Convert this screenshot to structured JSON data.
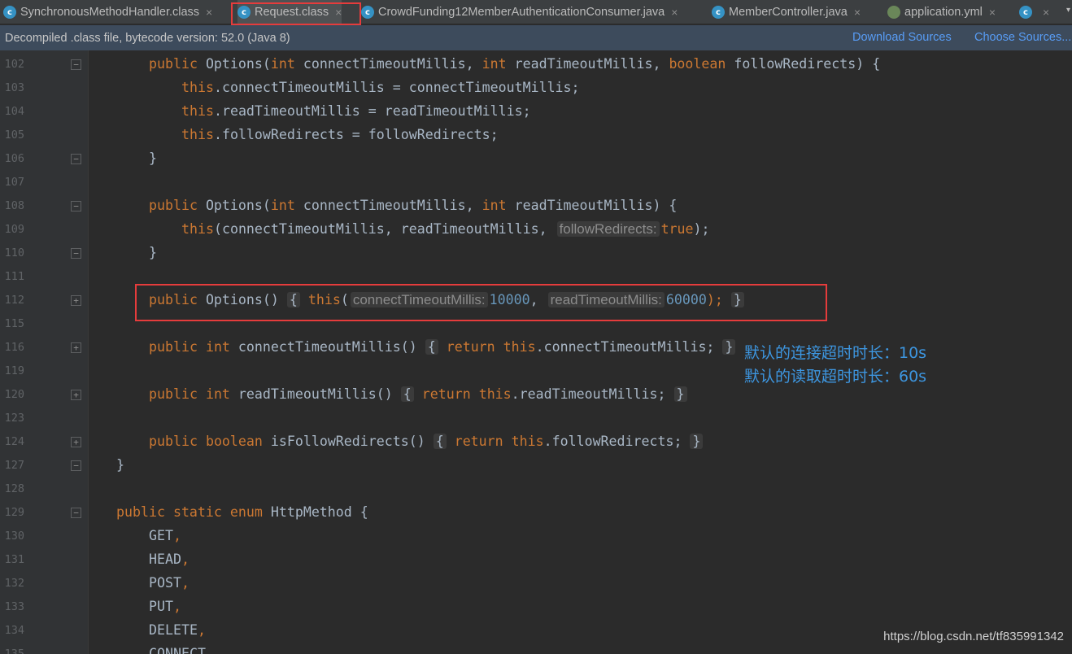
{
  "tabs": [
    {
      "label": "SynchronousMethodHandler.class",
      "icon": "class-c-icon"
    },
    {
      "label": "Request.class",
      "icon": "class-c-icon"
    },
    {
      "label": "CrowdFunding12MemberAuthenticationConsumer.java",
      "icon": "class-c-icon"
    },
    {
      "label": "MemberController.java",
      "icon": "class-c-icon"
    },
    {
      "label": "application.yml",
      "icon": "yml-icon"
    }
  ],
  "tab_icon_letter": "c",
  "tab_close": "×",
  "tab_overflow": "▾",
  "banner": {
    "text": "Decompiled .class file, bytecode version: 52.0 (Java 8)",
    "download": "Download Sources",
    "choose": "Choose Sources..."
  },
  "lines": {
    "l102": {
      "ln": "102",
      "kw1": "public",
      "t1": " Options(",
      "kw2": "int",
      "t2": " connectTimeoutMillis, ",
      "kw3": "int",
      "t3": " readTimeoutMillis, ",
      "kw4": "boolean",
      "t4": " followRedirects) {"
    },
    "l103": {
      "ln": "103",
      "kw1": "this",
      "t1": ".connectTimeoutMillis = connectTimeoutMillis;"
    },
    "l104": {
      "ln": "104",
      "kw1": "this",
      "t1": ".readTimeoutMillis = readTimeoutMillis;"
    },
    "l105": {
      "ln": "105",
      "kw1": "this",
      "t1": ".followRedirects = followRedirects;"
    },
    "l106": {
      "ln": "106",
      "t1": "}"
    },
    "l107": {
      "ln": "107"
    },
    "l108": {
      "ln": "108",
      "kw1": "public",
      "t1": " Options(",
      "kw2": "int",
      "t2": " connectTimeoutMillis, ",
      "kw3": "int",
      "t3": " readTimeoutMillis) {"
    },
    "l109": {
      "ln": "109",
      "kw1": "this",
      "t1": "(connectTimeoutMillis, readTimeoutMillis, ",
      "hint1": "followRedirects:",
      "kw2": "true",
      "t2": ");"
    },
    "l110": {
      "ln": "110",
      "t1": "}"
    },
    "l111": {
      "ln": "111"
    },
    "l112": {
      "ln": "112",
      "kw1": "public",
      "t1": " Options()",
      "b1": "{",
      "kw2": "this",
      "t2": "(",
      "hint1": "connectTimeoutMillis:",
      "n1": "10000",
      "t3": ", ",
      "hint2": "readTimeoutMillis:",
      "n2": "60000",
      "t4": ");",
      "b2": "}"
    },
    "l115": {
      "ln": "115"
    },
    "l116": {
      "ln": "116",
      "kw1": "public",
      "t1": " ",
      "kw2": "int",
      "t2": " connectTimeoutMillis()",
      "b1": "{",
      "kw3": "return",
      "t3": " ",
      "kw4": "this",
      "t4": ".connectTimeoutMillis;",
      "b2": "}"
    },
    "l119": {
      "ln": "119"
    },
    "l120": {
      "ln": "120",
      "kw1": "public",
      "t1": " ",
      "kw2": "int",
      "t2": " readTimeoutMillis()",
      "b1": "{",
      "kw3": "return",
      "t3": " ",
      "kw4": "this",
      "t4": ".readTimeoutMillis;",
      "b2": "}"
    },
    "l123": {
      "ln": "123"
    },
    "l124": {
      "ln": "124",
      "kw1": "public",
      "t1": " ",
      "kw2": "boolean",
      "t2": " isFollowRedirects()",
      "b1": "{",
      "kw3": "return",
      "t3": " ",
      "kw4": "this",
      "t4": ".followRedirects;",
      "b2": "}"
    },
    "l127": {
      "ln": "127",
      "t1": "}"
    },
    "l128": {
      "ln": "128"
    },
    "l129": {
      "ln": "129",
      "kw1": "public",
      "t1": " ",
      "kw2": "static",
      "t2": " ",
      "kw3": "enum",
      "t3": " HttpMethod {"
    },
    "l130": {
      "ln": "130",
      "t1": "GET",
      "kw1": ","
    },
    "l131": {
      "ln": "131",
      "t1": "HEAD",
      "kw1": ","
    },
    "l132": {
      "ln": "132",
      "t1": "POST",
      "kw1": ","
    },
    "l133": {
      "ln": "133",
      "t1": "PUT",
      "kw1": ","
    },
    "l134": {
      "ln": "134",
      "t1": "DELETE",
      "kw1": ","
    },
    "l135": {
      "ln": "135",
      "t1": "CONNECT"
    }
  },
  "fold_minus": "−",
  "fold_plus": "+",
  "notes": {
    "connect": "默认的连接超时时长：10s",
    "read": "默认的读取超时时长：60s"
  },
  "watermark": "https://blog.csdn.net/tf835991342",
  "colors": {
    "keyword": "#cc7832",
    "number": "#6897bb",
    "text": "#a9b7c6",
    "highlight_box": "#e53c3c",
    "note": "#3d96e0"
  }
}
